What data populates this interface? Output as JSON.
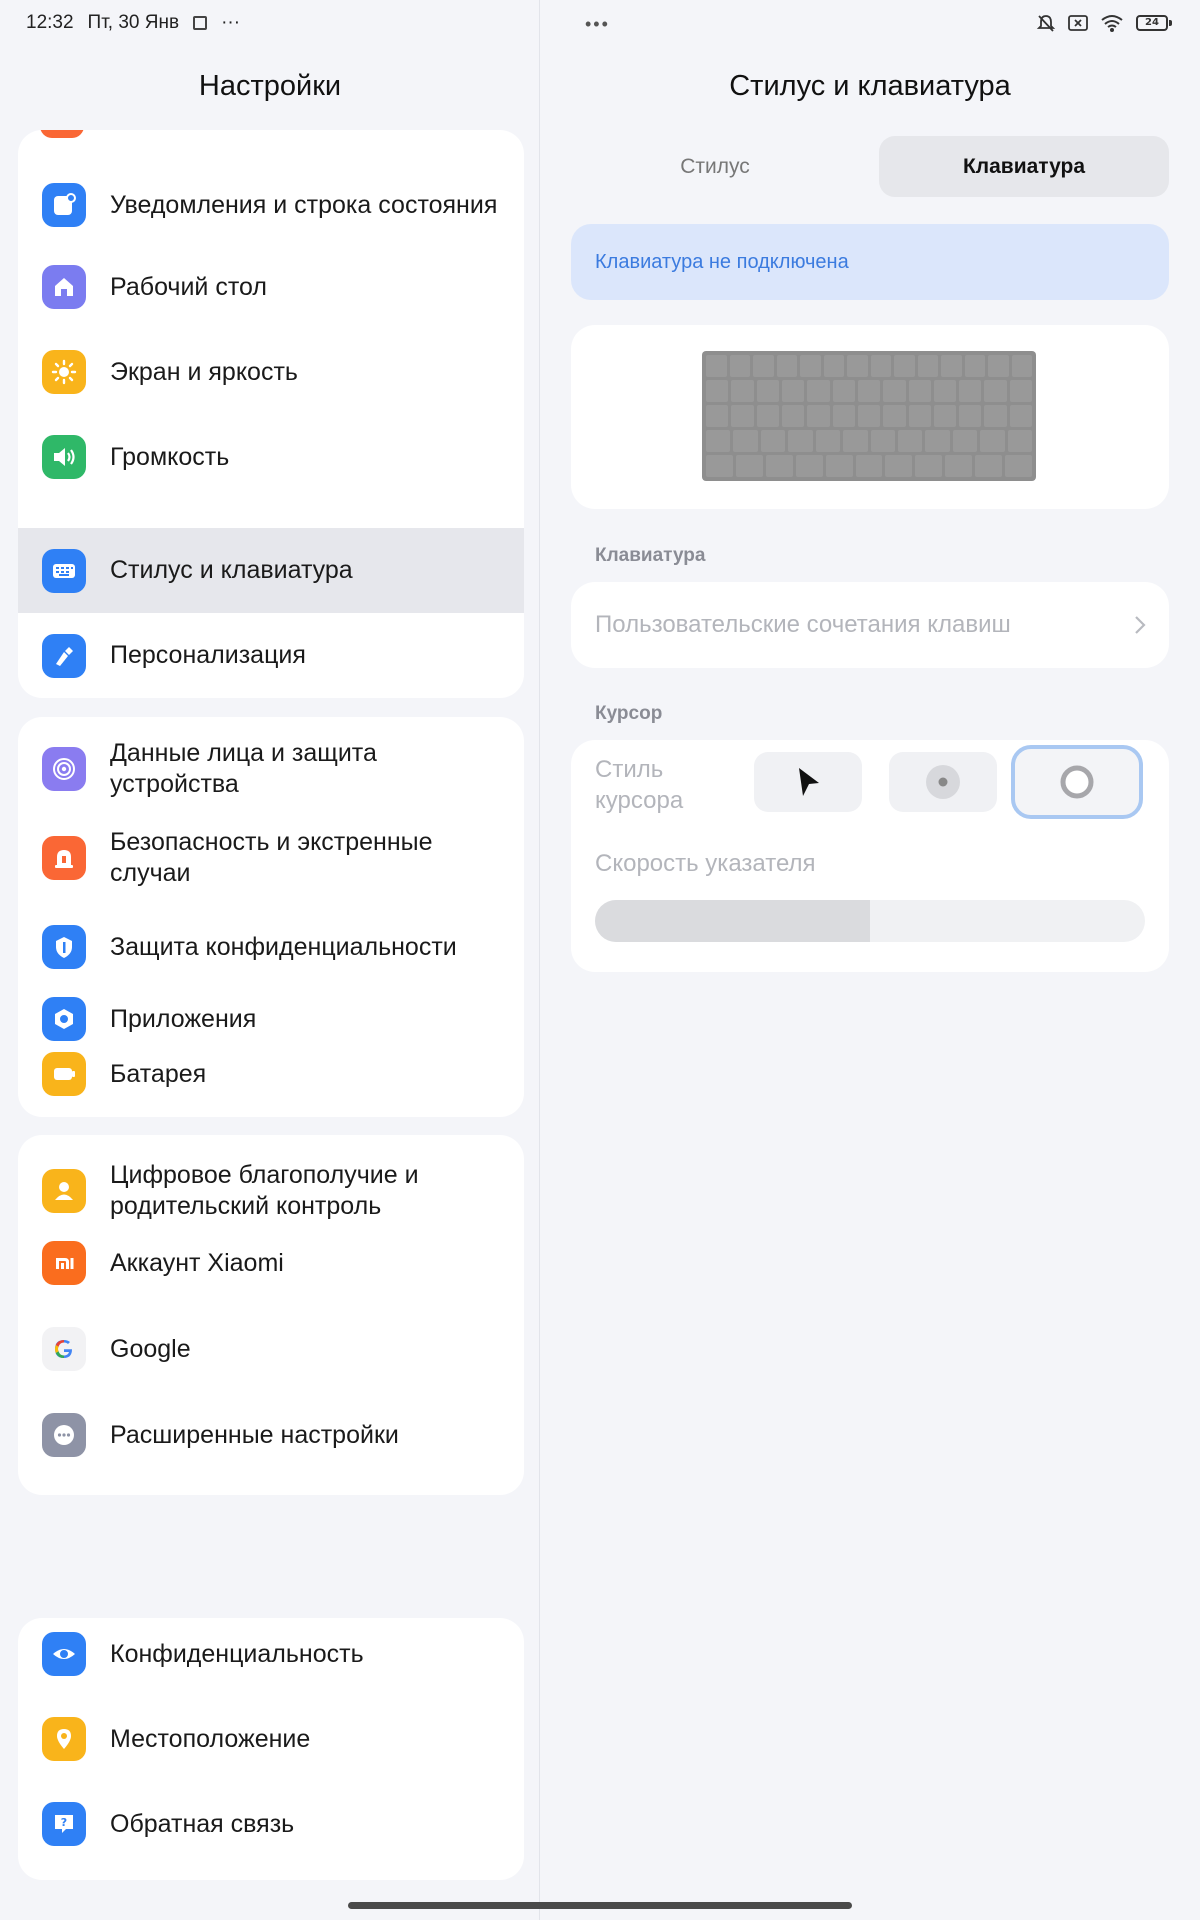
{
  "status_bar": {
    "time": "12:32",
    "date": "Пт, 30 Янв",
    "more": "···",
    "center_dots": "•••",
    "battery": "24"
  },
  "left_pane": {
    "title": "Настройки",
    "groups": [
      {
        "items": [
          {
            "label": "Уведомления и строка состояния",
            "icon": "notifications-icon",
            "color": "#2f80f5"
          },
          {
            "label": "Рабочий стол",
            "icon": "home-icon",
            "color": "#7b7cf0"
          },
          {
            "label": "Экран и яркость",
            "icon": "sun-icon",
            "color": "#f9b41b"
          },
          {
            "label": "Громкость",
            "icon": "volume-icon",
            "color": "#2fb868"
          },
          {
            "label": "Стилус и клавиатура",
            "icon": "keyboard-icon",
            "color": "#2f80f5",
            "selected": true
          },
          {
            "label": "Персонализация",
            "icon": "brush-icon",
            "color": "#2f80f5"
          }
        ]
      },
      {
        "items": [
          {
            "label": "Данные лица и защита устройства",
            "icon": "face-lock-icon",
            "color": "#8a7cf0"
          },
          {
            "label": "Безопасность и экстренные случаи",
            "icon": "emergency-icon",
            "color": "#fa6735"
          },
          {
            "label": "Защита конфиденциальности",
            "icon": "privacy-shield-icon",
            "color": "#2f80f5"
          },
          {
            "label": "Приложения",
            "icon": "apps-icon",
            "color": "#2f80f5"
          },
          {
            "label": "Батарея",
            "icon": "battery-icon",
            "color": "#f9b41b"
          }
        ]
      },
      {
        "items": [
          {
            "label": "Цифровое благополучие и родительский контроль",
            "icon": "wellbeing-icon",
            "color": "#f9b41b"
          },
          {
            "label": "Аккаунт Xiaomi",
            "icon": "xiaomi-icon",
            "color": "#fa6d1e"
          },
          {
            "label": "Google",
            "icon": "google-icon",
            "color": "#ffffff"
          },
          {
            "label": "Расширенные настройки",
            "icon": "more-icon",
            "color": "#8e93a6"
          }
        ]
      },
      {
        "items": [
          {
            "label": "Конфиденциальность",
            "icon": "eye-icon",
            "color": "#2f80f5"
          },
          {
            "label": "Местоположение",
            "icon": "location-icon",
            "color": "#f9b41b"
          },
          {
            "label": "Обратная связь",
            "icon": "feedback-icon",
            "color": "#2f80f5"
          }
        ]
      }
    ]
  },
  "right_pane": {
    "title": "Стилус и клавиатура",
    "tabs": [
      {
        "label": "Стилус",
        "active": false
      },
      {
        "label": "Клавиатура",
        "active": true
      }
    ],
    "banner": "Клавиатура не подключена",
    "keyboard_section": {
      "label": "Клавиатура",
      "shortcuts": "Пользовательские сочетания клавиш"
    },
    "cursor_section": {
      "label": "Курсор",
      "style_label": "Стиль курсора",
      "options": [
        "arrow-cursor-icon",
        "dot-cursor-icon",
        "ring-cursor-icon"
      ],
      "selected_option": 2,
      "speed_label": "Скорость указателя",
      "speed_value": 0.5
    }
  },
  "colors": {
    "accent": "#2f80f5",
    "banner_bg": "#dbe6fb",
    "banner_text": "#3b7bdf",
    "background": "#f4f5f9"
  }
}
